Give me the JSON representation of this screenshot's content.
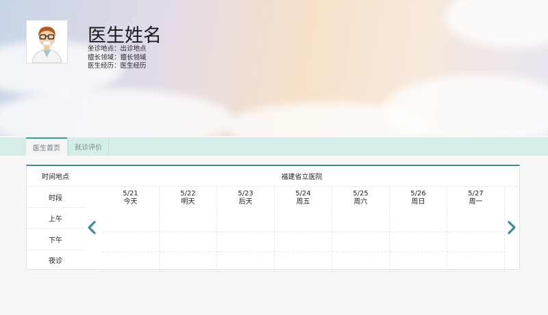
{
  "doctor": {
    "name": "医生姓名",
    "location_label": "坐诊地点：",
    "location_value": "出诊地点",
    "specialty_label": "擅长领域：",
    "specialty_value": "擅长领域",
    "experience_label": "医生经历：",
    "experience_value": "医生经历"
  },
  "tabs": [
    {
      "label": "医生首页",
      "active": true
    },
    {
      "label": "就诊评价",
      "active": false
    }
  ],
  "schedule": {
    "hospital": "福建省立医院",
    "row_headers": [
      "时间地点",
      "时段",
      "上午",
      "下午",
      "夜诊"
    ],
    "days": [
      {
        "date": "5/21",
        "weekday": "今天"
      },
      {
        "date": "5/22",
        "weekday": "明天"
      },
      {
        "date": "5/23",
        "weekday": "后天"
      },
      {
        "date": "5/24",
        "weekday": "周五"
      },
      {
        "date": "5/25",
        "weekday": "周六"
      },
      {
        "date": "5/26",
        "weekday": "周日"
      },
      {
        "date": "5/27",
        "weekday": "周一"
      }
    ],
    "prev_icon": "chevron-left-icon",
    "next_icon": "chevron-right-icon"
  },
  "colors": {
    "accent": "#3a8a98",
    "tab_bar": "#d4ede8",
    "arrow": "#3a8a98"
  }
}
